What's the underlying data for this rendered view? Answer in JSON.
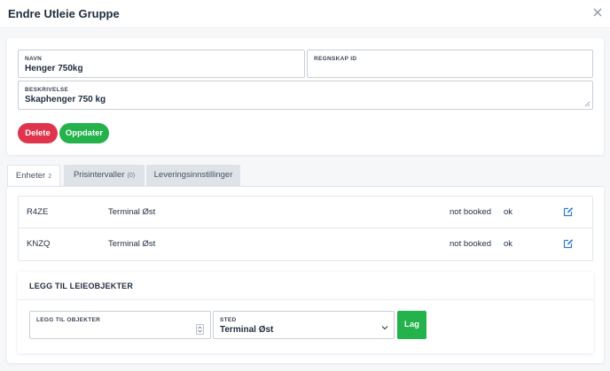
{
  "modal": {
    "title": "Endre Utleie Gruppe"
  },
  "form": {
    "navn": {
      "label": "NAVN",
      "value": "Henger 750kg"
    },
    "regnskap_id": {
      "label": "REGNSKAP ID",
      "value": ""
    },
    "beskrivelse": {
      "label": "BESKRIVELSE",
      "value": "Skaphenger 750 kg"
    },
    "delete_label": "Delete",
    "update_label": "Oppdater"
  },
  "tabs": [
    {
      "label": "Enheter",
      "count": "2",
      "active": true
    },
    {
      "label": "Prisintervaller",
      "count": "(0)",
      "active": false
    },
    {
      "label": "Leveringsinnstillinger",
      "count": "",
      "active": false
    }
  ],
  "units": [
    {
      "code": "R4ZE",
      "location": "Terminal Øst",
      "booking": "not booked",
      "status": "ok"
    },
    {
      "code": "KNZQ",
      "location": "Terminal Øst",
      "booking": "not booked",
      "status": "ok"
    }
  ],
  "add_section": {
    "title": "LEGG TIL LEIEOBJEKTER",
    "objects_field": {
      "label": "LEGG TIL OBJEKTER",
      "value": ""
    },
    "sted_field": {
      "label": "STED",
      "value": "Terminal Øst"
    },
    "submit_label": "Lag"
  },
  "colors": {
    "delete": "#e0344c",
    "success": "#23b24b",
    "edit_icon": "#2f7bd6"
  },
  "icons": {
    "close": "close-icon",
    "edit": "edit-icon",
    "select": "chevron-down-icon",
    "number_spinner": "spinner-icon",
    "resize": "resize-grip-icon"
  }
}
